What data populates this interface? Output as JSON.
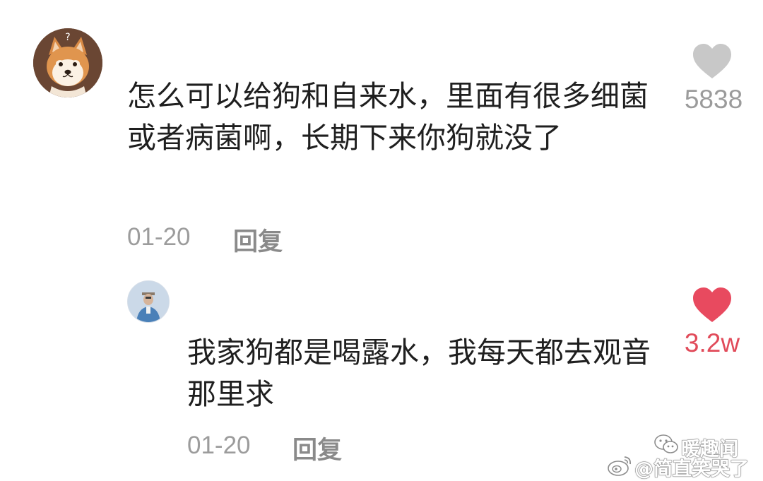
{
  "comments": [
    {
      "avatar": "shiba-dog-avatar",
      "text": "怎么可以给狗和自来水，里面有很多细菌或者病菌啊，长期下来你狗就没了",
      "date": "01-20",
      "reply_label": "回复",
      "likes": "5838",
      "liked": false
    },
    {
      "avatar": "person-avatar",
      "text": "我家狗都是喝露水，我每天都去观音那里求",
      "date": "01-20",
      "reply_label": "回复",
      "likes": "3.2w",
      "liked": true
    }
  ],
  "colors": {
    "like_inactive": "#c8c8c8",
    "like_active": "#e84a5f",
    "count_active": "#e14b5a",
    "meta_gray": "#9c9c9c"
  },
  "watermarks": [
    {
      "icon": "wechat-icon",
      "text": "暖趣闻"
    },
    {
      "icon": "weibo-icon",
      "text": "@简直笑哭了"
    }
  ]
}
